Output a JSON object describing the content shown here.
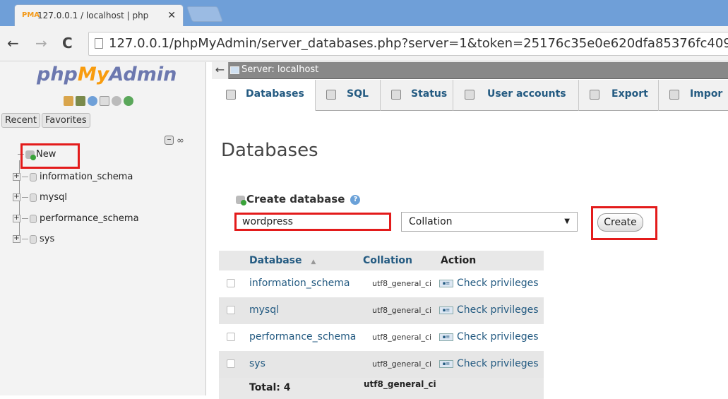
{
  "browser": {
    "tab_title": "127.0.0.1 / localhost | php",
    "tab_close": "✕",
    "favicon_text": "PMA",
    "url": "127.0.0.1/phpMyAdmin/server_databases.php?server=1&token=25176c35e0e620dfa85376fc4098202"
  },
  "sidebar": {
    "logo_php": "php",
    "logo_my": "My",
    "logo_admin": "Admin",
    "tabs": [
      "Recent",
      "Favorites"
    ],
    "tree": [
      {
        "label": "New"
      },
      {
        "label": "information_schema"
      },
      {
        "label": "mysql"
      },
      {
        "label": "performance_schema"
      },
      {
        "label": "sys"
      }
    ]
  },
  "main": {
    "server_label": "Server: localhost",
    "menu_tabs": [
      "Databases",
      "SQL",
      "Status",
      "User accounts",
      "Export",
      "Impor"
    ],
    "page_title": "Databases",
    "create_header": "Create database",
    "db_name_value": "wordpress",
    "collation_value": "Collation",
    "create_button": "Create",
    "table": {
      "headers": [
        "Database",
        "Collation",
        "Action"
      ],
      "sort_indicator": "▲",
      "rows": [
        {
          "name": "information_schema",
          "collation": "utf8_general_ci",
          "action": "Check privileges"
        },
        {
          "name": "mysql",
          "collation": "utf8_general_ci",
          "action": "Check privileges"
        },
        {
          "name": "performance_schema",
          "collation": "utf8_general_ci",
          "action": "Check privileges"
        },
        {
          "name": "sys",
          "collation": "utf8_general_ci",
          "action": "Check privileges"
        }
      ],
      "total_label": "Total: 4",
      "total_collation": "utf8_general_ci"
    }
  }
}
